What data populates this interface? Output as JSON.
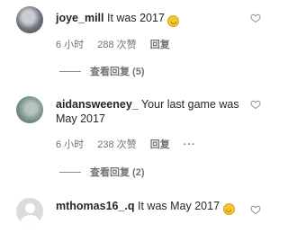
{
  "comments": [
    {
      "username": "joye_mill",
      "text": "It was 2017",
      "emoji": "😂",
      "time": "6 小时",
      "likes": "288 次赞",
      "reply_label": "回复",
      "view_replies": "查看回复 (5)"
    },
    {
      "username": "aidansweeney_",
      "text": "Your last game was May 2017",
      "time": "6 小时",
      "likes": "238 次赞",
      "reply_label": "回复",
      "more": "···",
      "view_replies": "查看回复 (2)"
    },
    {
      "username": "mthomas16_.q",
      "text": "It was May 2017",
      "emoji": "😂"
    }
  ],
  "icons": {
    "emoji": "laughing-tears-emoji",
    "like": "heart-outline-icon",
    "avatar_placeholder": "default-avatar-icon"
  }
}
